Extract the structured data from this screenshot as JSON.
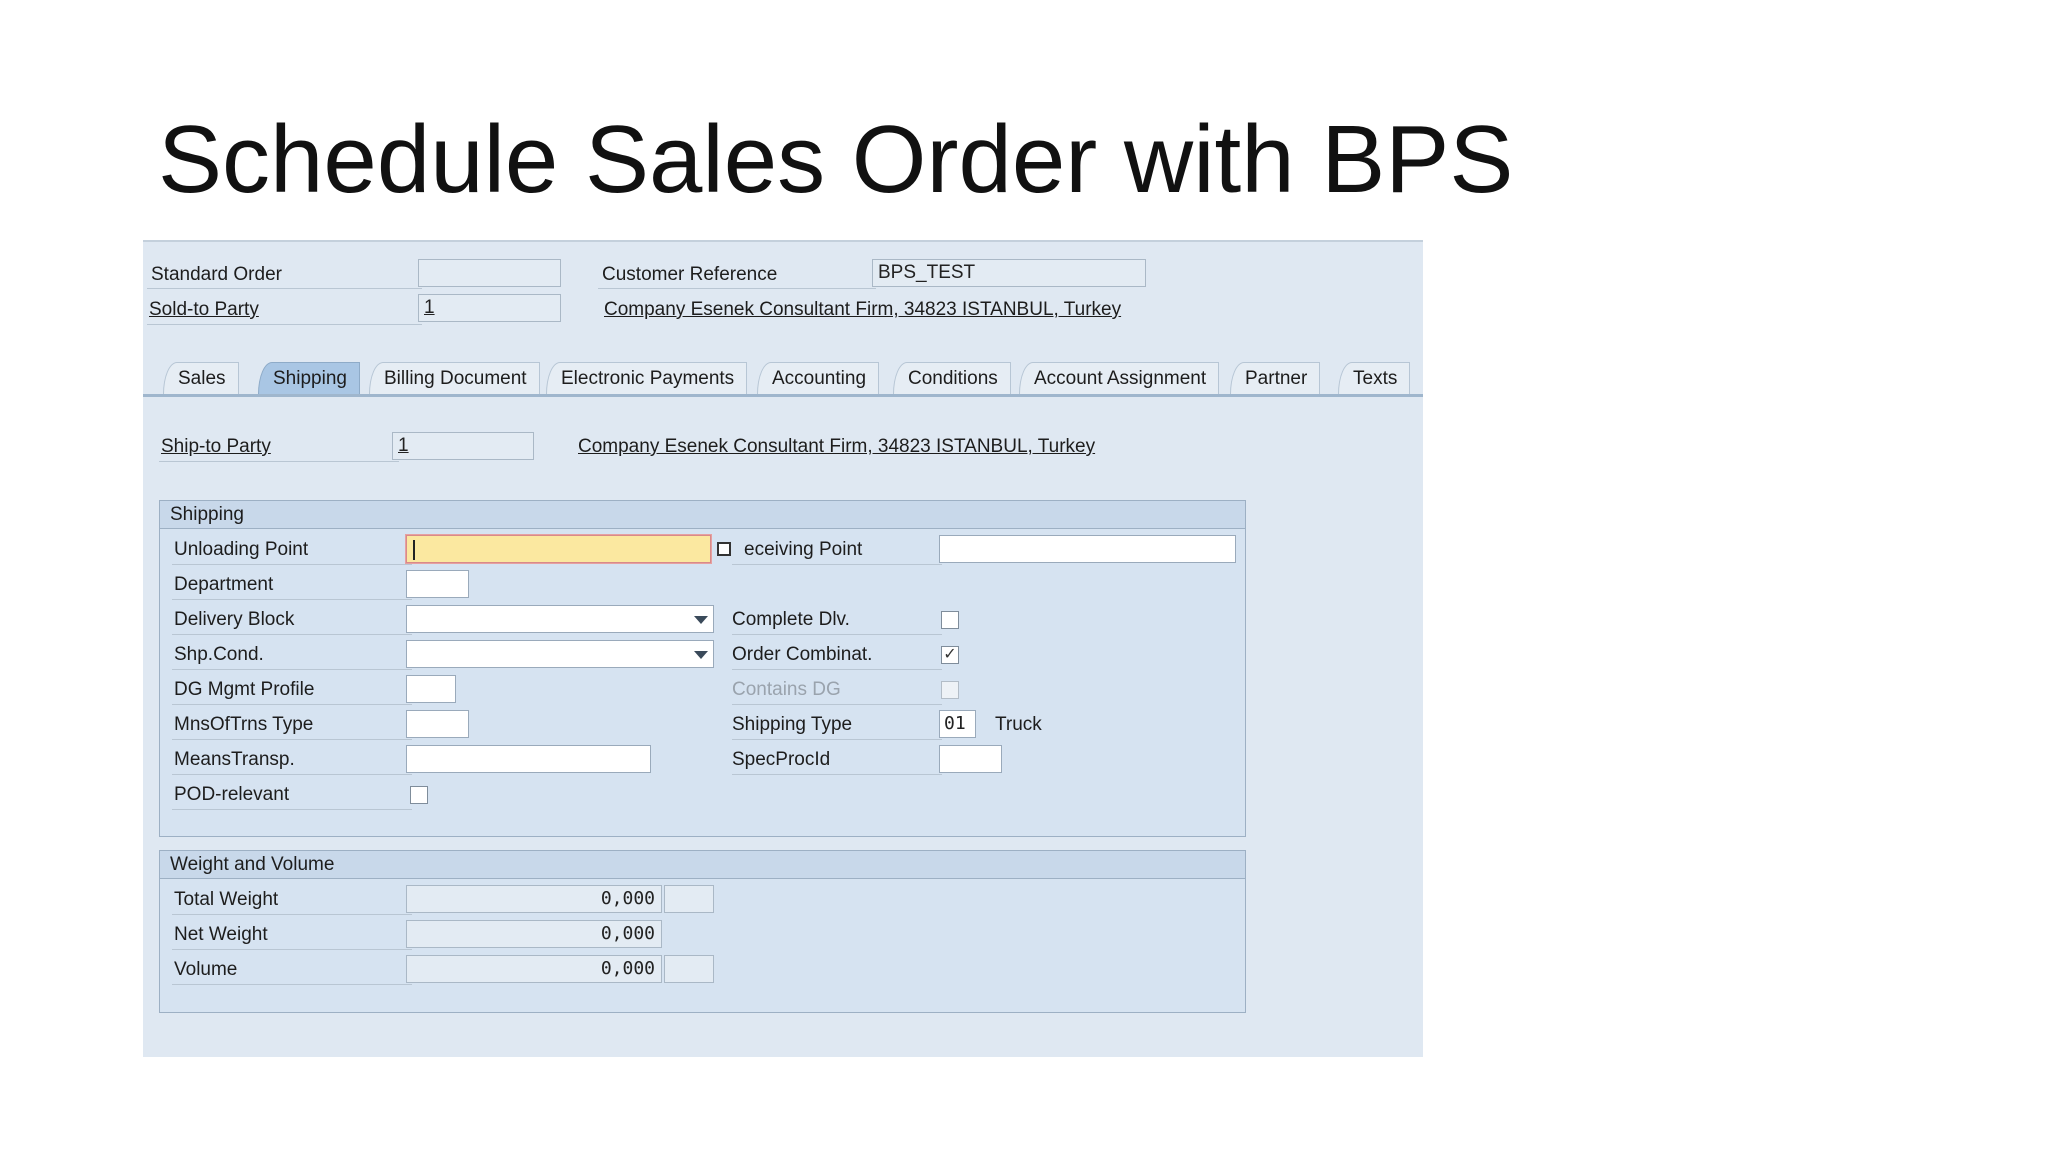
{
  "slide": {
    "title": "Schedule Sales Order with BPS"
  },
  "header": {
    "standard_order_label": "Standard Order",
    "standard_order_value": "",
    "sold_to_label": "Sold-to Party",
    "sold_to_value": "1",
    "customer_reference_label": "Customer Reference",
    "customer_reference_value": "BPS_TEST",
    "sold_to_address": "Company Esenek Consultant Firm, 34823 ISTANBUL, Turkey"
  },
  "tabs": [
    {
      "label": "Sales"
    },
    {
      "label": "Shipping",
      "active": true
    },
    {
      "label": "Billing Document"
    },
    {
      "label": "Electronic Payments"
    },
    {
      "label": "Accounting"
    },
    {
      "label": "Conditions"
    },
    {
      "label": "Account Assignment"
    },
    {
      "label": "Partner"
    },
    {
      "label": "Texts"
    }
  ],
  "ship_to": {
    "label": "Ship-to Party",
    "value": "1",
    "address": "Company Esenek Consultant Firm, 34823 ISTANBUL, Turkey"
  },
  "shipping": {
    "title": "Shipping",
    "unloading_point_label": "Unloading Point",
    "unloading_point_value": "",
    "receiving_point_label": "eceiving Point",
    "receiving_point_value": "",
    "department_label": "Department",
    "department_value": "",
    "delivery_block_label": "Delivery Block",
    "delivery_block_value": "",
    "shp_cond_label": "Shp.Cond.",
    "shp_cond_value": "",
    "dg_mgmt_label": "DG Mgmt Profile",
    "dg_mgmt_value": "",
    "mnsoftrns_label": "MnsOfTrns Type",
    "mnsoftrns_value": "",
    "meanstransp_label": "MeansTransp.",
    "meanstransp_value": "",
    "pod_label": "POD-relevant",
    "pod_checked": false,
    "complete_dlv_label": "Complete Dlv.",
    "complete_dlv_checked": false,
    "order_combinat_label": "Order Combinat.",
    "order_combinat_checked": true,
    "order_combinat_mark": "✓",
    "contains_dg_label": "Contains DG",
    "contains_dg_checked": false,
    "shipping_type_label": "Shipping Type",
    "shipping_type_value": "01",
    "shipping_type_text": "Truck",
    "specprocid_label": "SpecProcId",
    "specprocid_value": ""
  },
  "weight_volume": {
    "title": "Weight and Volume",
    "total_weight_label": "Total Weight",
    "total_weight_value": "0,000",
    "total_weight_unit": "",
    "net_weight_label": "Net Weight",
    "net_weight_value": "0,000",
    "volume_label": "Volume",
    "volume_value": "0,000",
    "volume_unit": ""
  },
  "colors": {
    "panel_bg": "#dfe8f2",
    "active_tab": "#a9c6e4",
    "focus_field": "#fbe8a0"
  }
}
